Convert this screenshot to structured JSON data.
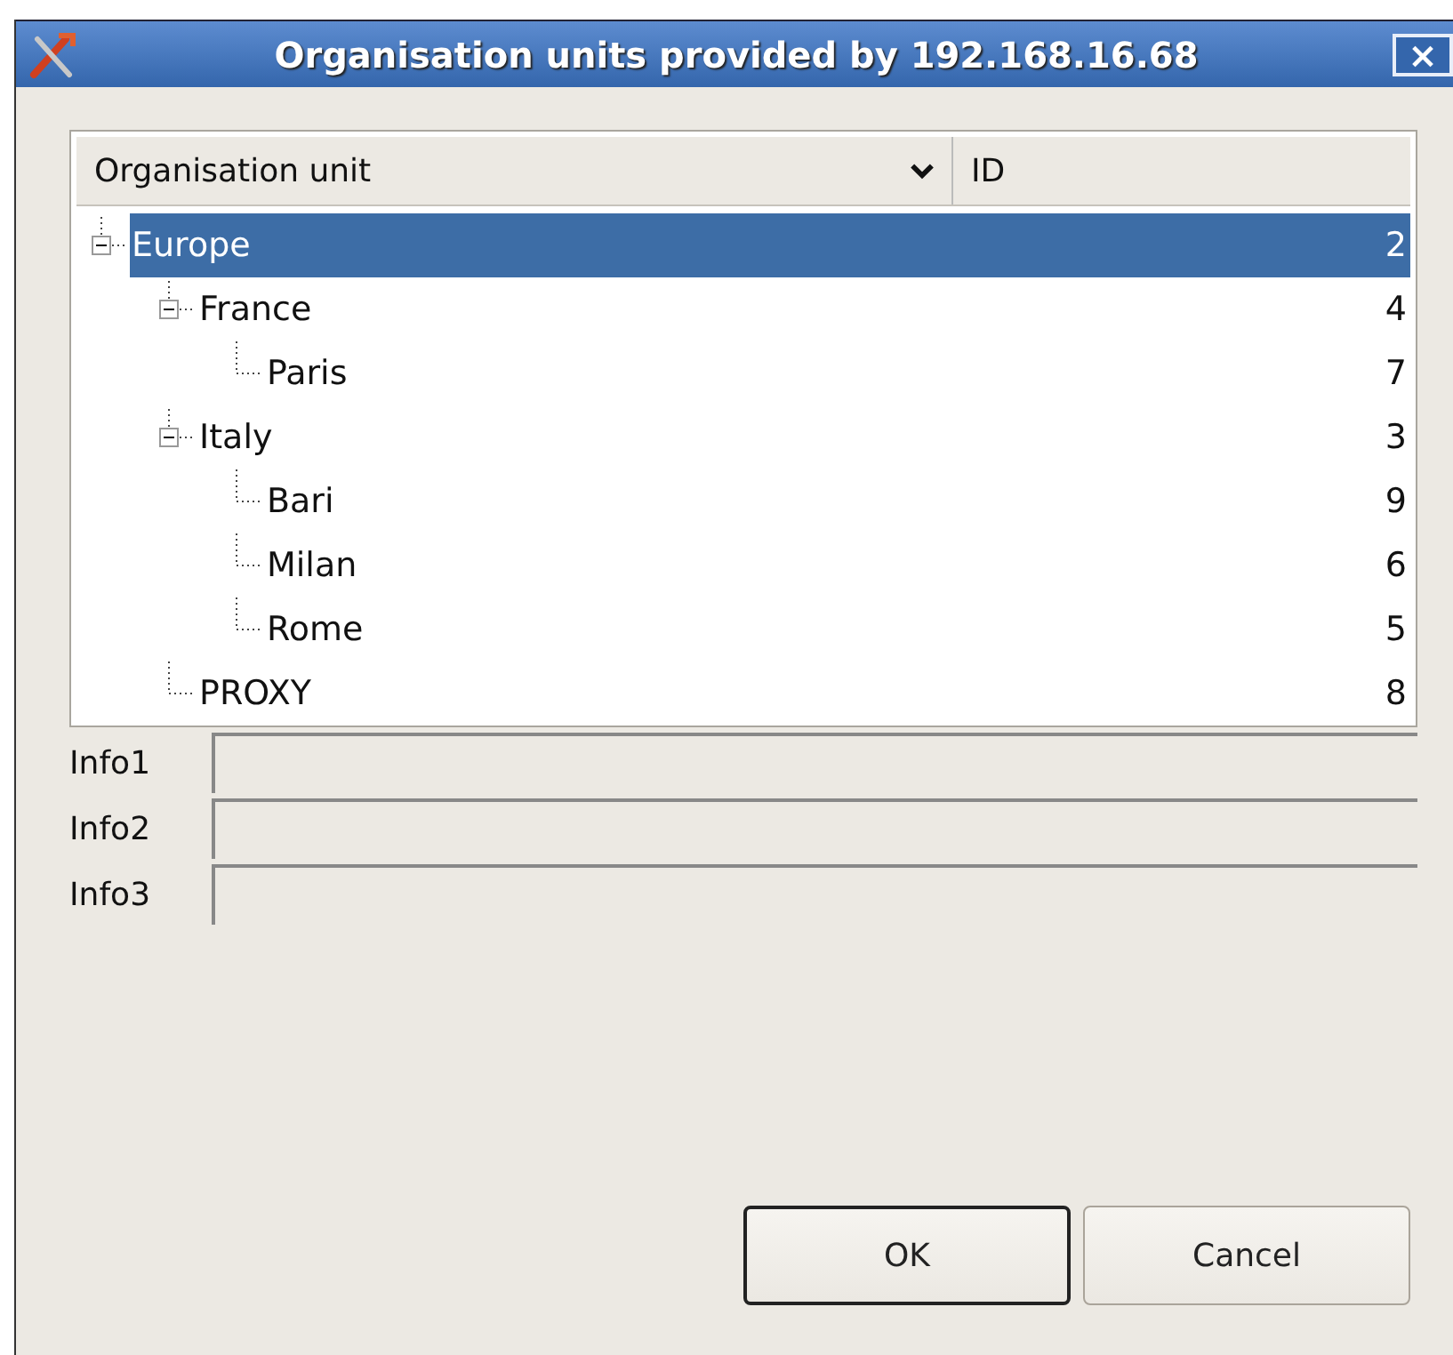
{
  "window": {
    "title": "Organisation units provided by 192.168.16.68",
    "close": "×"
  },
  "tree": {
    "columns": [
      "Organisation unit",
      "ID"
    ],
    "rows": [
      {
        "name": "Europe",
        "id": "2",
        "selected": true,
        "expanded": true,
        "children": [
          {
            "name": "France",
            "id": "4",
            "selected": false,
            "expanded": true,
            "children": [
              {
                "name": "Paris",
                "id": "7",
                "selected": false
              }
            ]
          },
          {
            "name": "Italy",
            "id": "3",
            "selected": false,
            "expanded": true,
            "children": [
              {
                "name": "Bari",
                "id": "9",
                "selected": false
              },
              {
                "name": "Milan",
                "id": "6",
                "selected": false
              },
              {
                "name": "Rome",
                "id": "5",
                "selected": false
              }
            ]
          },
          {
            "name": "PROXY",
            "id": "8",
            "selected": false
          }
        ]
      }
    ]
  },
  "info_fields": [
    {
      "label": "Info1"
    },
    {
      "label": "Info2"
    },
    {
      "label": "Info3"
    }
  ],
  "buttons": [
    {
      "label": "OK",
      "kind": "default"
    },
    {
      "label": "Cancel",
      "kind": "normal"
    }
  ]
}
